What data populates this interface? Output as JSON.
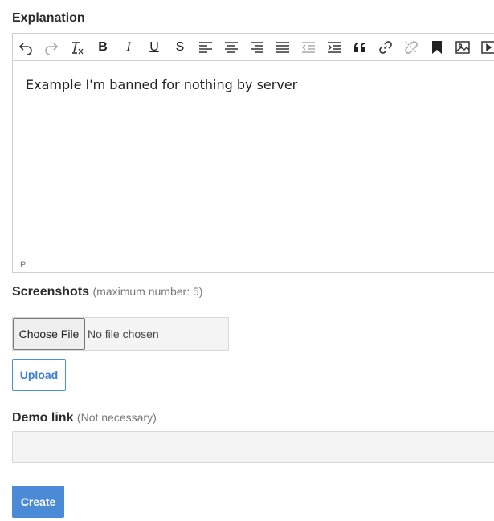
{
  "explanation": {
    "label": "Explanation",
    "content": "Example I'm banned for nothing by server",
    "status_path": "P",
    "toolbar": [
      {
        "icon": "undo-icon"
      },
      {
        "icon": "redo-icon"
      },
      {
        "icon": "clear-formatting-icon"
      },
      {
        "icon": "bold-icon",
        "glyph": "B"
      },
      {
        "icon": "italic-icon",
        "glyph": "I"
      },
      {
        "icon": "underline-icon",
        "glyph": "U"
      },
      {
        "icon": "strikethrough-icon",
        "glyph": "S"
      },
      {
        "icon": "align-left-icon"
      },
      {
        "icon": "align-center-icon"
      },
      {
        "icon": "align-right-icon"
      },
      {
        "icon": "align-justify-icon"
      },
      {
        "icon": "outdent-icon"
      },
      {
        "icon": "indent-icon"
      },
      {
        "icon": "blockquote-icon"
      },
      {
        "icon": "link-icon"
      },
      {
        "icon": "unlink-icon"
      },
      {
        "icon": "bookmark-icon"
      },
      {
        "icon": "image-icon"
      },
      {
        "icon": "media-icon"
      }
    ]
  },
  "screenshots": {
    "label": "Screenshots",
    "hint": "(maximum number: 5)",
    "choose_file_label": "Choose File",
    "file_status": "No file chosen",
    "upload_label": "Upload"
  },
  "demo_link": {
    "label": "Demo link",
    "hint": "(Not necessary)",
    "value": ""
  },
  "create_label": "Create"
}
